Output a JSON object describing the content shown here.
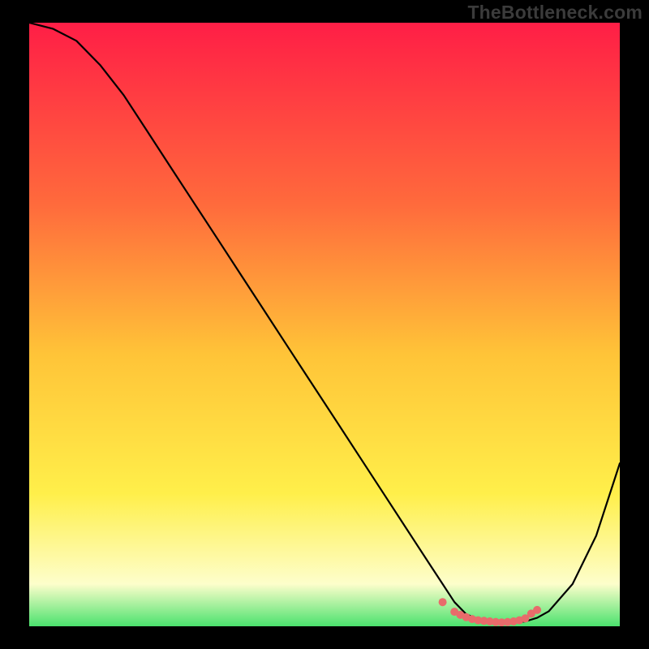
{
  "watermark": "TheBottleneck.com",
  "colors": {
    "bg_black": "#000000",
    "curve": "#000000",
    "marker": "#e86b6b",
    "grad_top": "#ff1e46",
    "grad_mid1": "#ff6a3c",
    "grad_mid2": "#ffc438",
    "grad_mid3": "#ffef4a",
    "grad_bottom1": "#fdfecb",
    "grad_bottom2": "#4be26e"
  },
  "chart_data": {
    "type": "line",
    "title": "",
    "xlabel": "",
    "ylabel": "",
    "xlim": [
      0,
      100
    ],
    "ylim": [
      0,
      100
    ],
    "x": [
      0,
      4,
      8,
      12,
      16,
      20,
      24,
      28,
      32,
      36,
      40,
      44,
      48,
      52,
      56,
      60,
      64,
      68,
      70,
      72,
      74,
      76,
      78,
      80,
      82,
      84,
      86,
      88,
      92,
      96,
      100
    ],
    "values": [
      100,
      99,
      97,
      93,
      88,
      82,
      76,
      70,
      64,
      58,
      52,
      46,
      40,
      34,
      28,
      22,
      16,
      10,
      7,
      4,
      2,
      1.2,
      0.8,
      0.6,
      0.6,
      0.8,
      1.4,
      2.5,
      7,
      15,
      27
    ],
    "markers_around_min": {
      "x": [
        70,
        72,
        73,
        74,
        75,
        76,
        77,
        78,
        79,
        80,
        81,
        82,
        83,
        84,
        85,
        86
      ],
      "values": [
        4,
        2.4,
        1.9,
        1.5,
        1.2,
        1.0,
        0.9,
        0.8,
        0.7,
        0.65,
        0.7,
        0.8,
        1.0,
        1.3,
        2.1,
        2.7
      ]
    }
  }
}
